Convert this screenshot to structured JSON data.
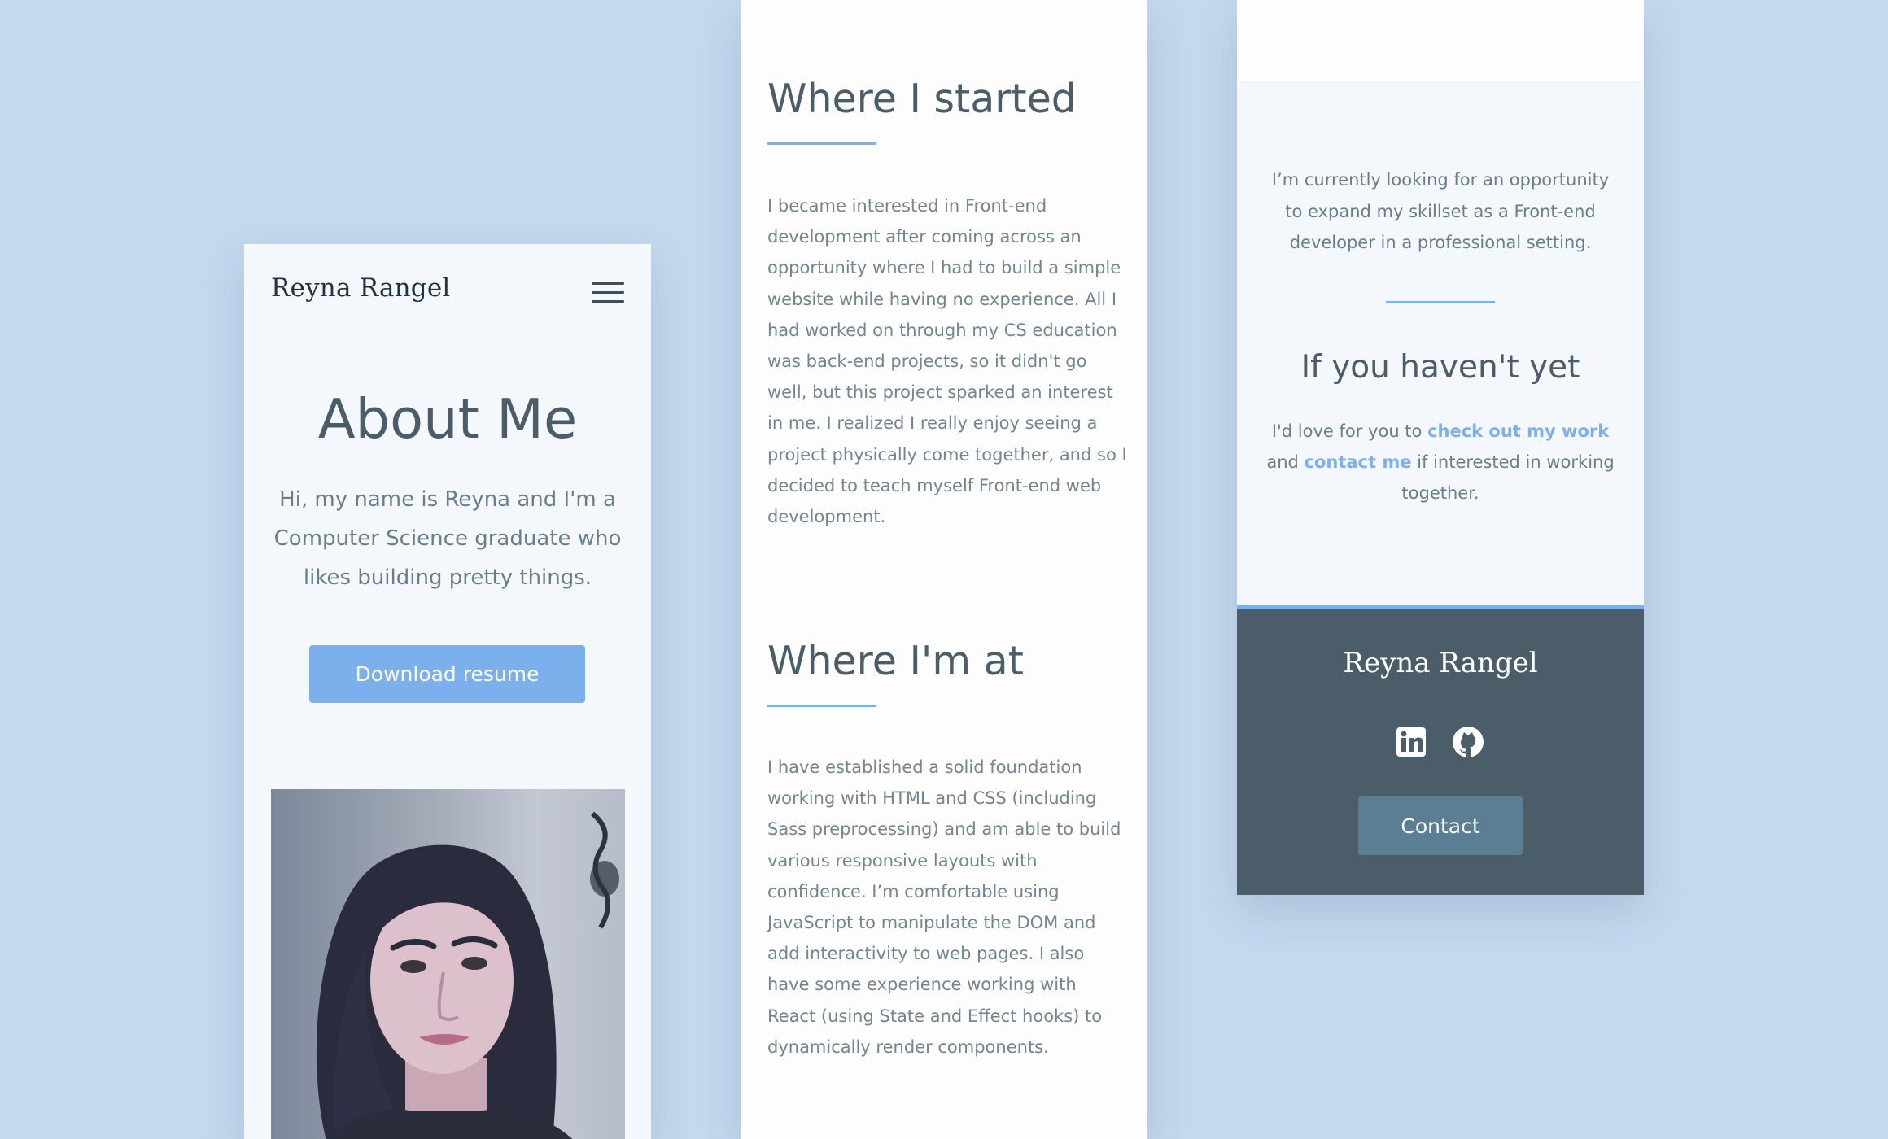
{
  "panel_one": {
    "brand": "Reyna Rangel",
    "menu_icon": "hamburger-menu-icon",
    "title": "About Me",
    "intro": "Hi, my name is Reyna and I'm a Computer Science graduate who likes building pretty things.",
    "resume_button": "Download resume"
  },
  "panel_two": {
    "started_title": "Where I started",
    "started_body": "I became interested in Front-end development after coming across an opportunity where I had to build a simple website while having no experience. All I had worked on through my CS education was back-end projects, so it didn't go well, but this project sparked an interest in me. I realized I really enjoy seeing a project physically come together, and so I decided to teach myself Front-end web development.",
    "at_title": "Where I'm at",
    "at_body": "I have established a solid foundation working with HTML and CSS (including Sass preprocessing) and am able to build various responsive layouts with confidence. I’m comfortable using JavaScript to manipulate the DOM and add interactivity to web pages. I also have some experience working with React (using State and Effect hooks) to dynamically render components."
  },
  "panel_three": {
    "looking": "I’m currently looking for an opportunity to expand my skillset as a Front-end developer in a professional setting.",
    "heading": "If you haven't yet",
    "cta_before": "I'd love for you to ",
    "cta_link_work": "check out my work",
    "cta_middle": " and ",
    "cta_link_contact": "contact me",
    "cta_after": " if interested in working together.",
    "footer_brand": "Reyna Rangel",
    "social_icons": [
      "linkedin-icon",
      "github-icon"
    ],
    "contact_button": "Contact"
  },
  "colors": {
    "background": "#c4d8ee",
    "accent": "#7cb0ec",
    "footer": "#4a5d68",
    "contact_button": "#5c7e93",
    "text": "#4a5d68"
  }
}
